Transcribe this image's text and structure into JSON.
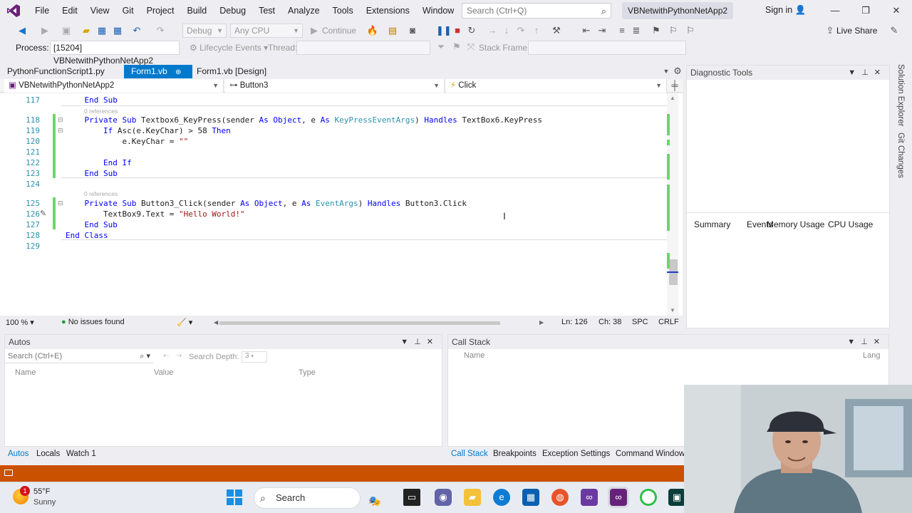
{
  "menu": [
    "File",
    "Edit",
    "View",
    "Git",
    "Project",
    "Build",
    "Debug",
    "Test",
    "Analyze",
    "Tools",
    "Extensions",
    "Window",
    "Help"
  ],
  "search": {
    "placeholder": "Search (Ctrl+Q)"
  },
  "solution_name": "VBNetwithPythonNetApp2",
  "sign_in": "Sign in",
  "toolbar": {
    "config": "Debug",
    "platform": "Any CPU",
    "continue": "Continue",
    "live_share": "Live Share"
  },
  "debug_location": {
    "process_label": "Process:",
    "process_value": "[15204] VBNetwithPythonNetApp2",
    "lifecycle": "Lifecycle Events",
    "thread_label": "Thread:",
    "stack_frame_label": "Stack Frame:"
  },
  "tabs": [
    {
      "label": "PythonFunctionScript1.py",
      "active": false
    },
    {
      "label": "Form1.vb",
      "active": true
    },
    {
      "label": "Form1.vb [Design]",
      "active": false
    }
  ],
  "navbar": {
    "project": "VBNetwithPythonNetApp2",
    "object": "Button3",
    "event": "Click"
  },
  "code": {
    "lines": [
      {
        "n": "117",
        "text": "    End Sub"
      },
      {
        "n": "118",
        "text": "    Private Sub Textbox6_KeyPress(sender As Object, e As KeyPressEventArgs) Handles TextBox6.KeyPress"
      },
      {
        "n": "119",
        "text": "        If Asc(e.KeyChar) > 58 Then"
      },
      {
        "n": "120",
        "text": "            e.KeyChar = \"\""
      },
      {
        "n": "121",
        "text": ""
      },
      {
        "n": "122",
        "text": "        End If"
      },
      {
        "n": "123",
        "text": "    End Sub"
      },
      {
        "n": "124",
        "text": ""
      },
      {
        "n": "125",
        "text": "    Private Sub Button3_Click(sender As Object, e As EventArgs) Handles Button3.Click"
      },
      {
        "n": "126",
        "text": "        TextBox9.Text = \"Hello World!\""
      },
      {
        "n": "127",
        "text": "    End Sub"
      },
      {
        "n": "128",
        "text": "End Class"
      },
      {
        "n": "129",
        "text": ""
      }
    ],
    "codelens": "0 references"
  },
  "editor_status": {
    "zoom": "100 %",
    "issues": "No issues found",
    "line": "Ln: 126",
    "col": "Ch: 38",
    "spc": "SPC",
    "eol": "CRLF"
  },
  "diagnostic": {
    "title": "Diagnostic Tools",
    "tabs": [
      "Summary",
      "Events",
      "Memory Usage",
      "CPU Usage"
    ]
  },
  "side_strip": [
    "Solution Explorer",
    "Git Changes"
  ],
  "autos": {
    "title": "Autos",
    "search_placeholder": "Search (Ctrl+E)",
    "search_depth_label": "Search Depth:",
    "search_depth_value": "3",
    "columns": [
      "Name",
      "Value",
      "Type"
    ]
  },
  "callstack": {
    "title": "Call Stack",
    "columns": [
      "Name",
      "Lang"
    ]
  },
  "bottom_tabs_left": [
    "Autos",
    "Locals",
    "Watch 1"
  ],
  "bottom_tabs_right": [
    "Call Stack",
    "Breakpoints",
    "Exception Settings",
    "Command Window"
  ],
  "weather": {
    "temp": "55°F",
    "desc": "Sunny",
    "badge": "1"
  },
  "taskbar_search": "Search",
  "colors": {
    "accent": "#007acc",
    "status_bar": "#ca5100",
    "vs_purple": "#68217a"
  }
}
